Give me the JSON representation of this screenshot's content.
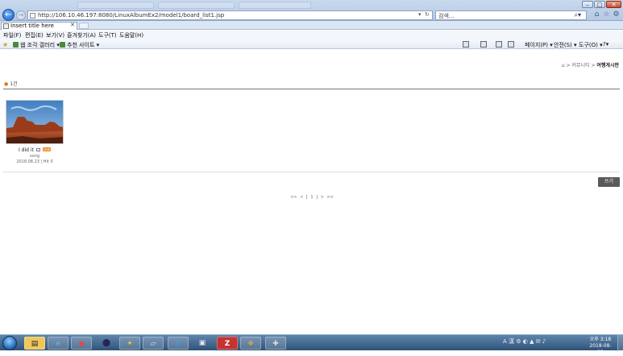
{
  "browser": {
    "address_url": "http://106.10.46.197:8080/LinuxAlbumEx2/model1/board_list1.jsp",
    "search_placeholder": "검색...",
    "tab_title": "Insert title here",
    "window_controls": {
      "minimize": "–",
      "maximize": "□",
      "close": "✕"
    }
  },
  "menu": [
    "파일(F)",
    "편집(E)",
    "보기(V)",
    "즐겨찾기(A)",
    "도구(T)",
    "도움말(H)"
  ],
  "command_bar": {
    "left_links": [
      "웹 조각 갤러리 ▾",
      "추천 사이트 ▾"
    ],
    "right_items": [
      "페이지(P) ▾",
      "안전(S) ▾",
      "도구(O) ▾",
      "?▾"
    ]
  },
  "page": {
    "breadcrumb": {
      "home_icon": "home-icon",
      "path": " > 커뮤니티 > ",
      "current": "여행게시판"
    },
    "total_count": "1건",
    "items": [
      {
        "title": "I did it",
        "new_badge": "new",
        "author": "song",
        "meta": "2018.08.23 | Hit 0",
        "image": "desert-mesa-photo"
      }
    ],
    "write_button": "쓰기",
    "pagination": "<< < [ 1 ] > >>"
  },
  "taskbar": {
    "icons": [
      "explorer-icon",
      "ie-icon",
      "chrome-icon",
      "eclipse-icon",
      "tool-icon",
      "window-icon",
      "vscode-icon",
      "putty-icon",
      "filezilla-icon",
      "app-icon",
      "network-icon"
    ],
    "tray_text": "A 漢 ⚙ ◐ ▲ ✉ ♪",
    "clock_time": "오후 3:18",
    "clock_date": "2018-08-23"
  },
  "colors": {
    "accent": "#1c5fc4",
    "new_badge": "#f08a24",
    "write_button": "#5a5a5a"
  }
}
